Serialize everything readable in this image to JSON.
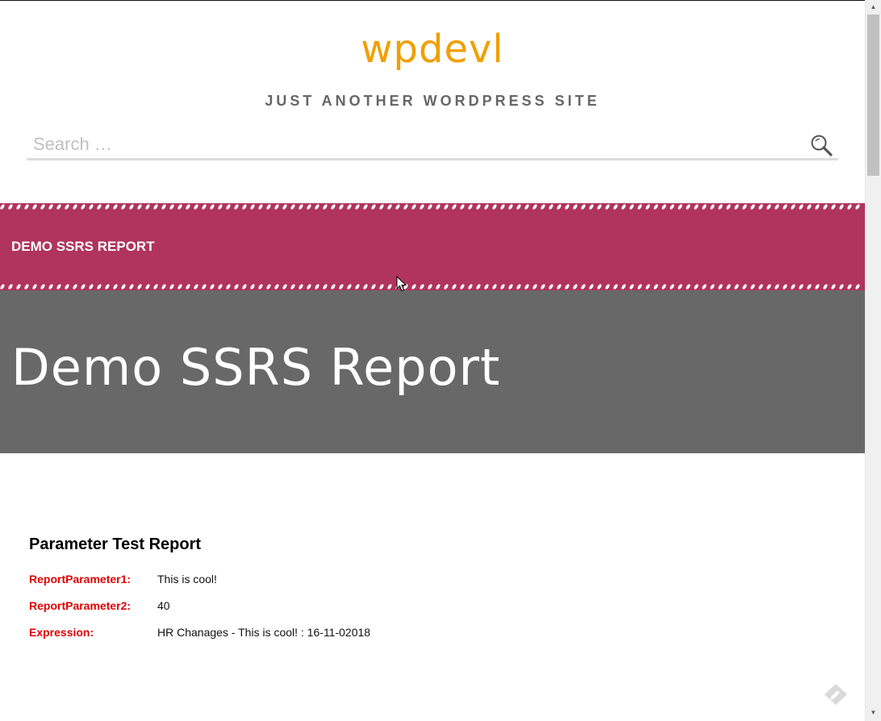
{
  "header": {
    "site_title": "wpdevl",
    "tagline": "JUST ANOTHER WORDPRESS SITE",
    "search_placeholder": "Search …"
  },
  "nav": {
    "items": [
      {
        "label": "DEMO SSRS REPORT"
      }
    ]
  },
  "hero": {
    "title": "Demo SSRS Report"
  },
  "report": {
    "title": "Parameter Test Report",
    "rows": [
      {
        "label": "ReportParameter1:",
        "value": "This is cool!"
      },
      {
        "label": "ReportParameter2:",
        "value": "40"
      },
      {
        "label": "Expression:",
        "value": "HR Chanages - This is cool! : 16-11-02018"
      }
    ]
  },
  "icons": {
    "search": "search-icon",
    "feedback": "feedback-icon",
    "scroll_up": "scroll-up-arrow-icon",
    "scroll_down": "scroll-down-arrow-icon"
  },
  "colors": {
    "site_title": "#f0a000",
    "nav_band": "#b0345d",
    "rope": "#ffffff",
    "hero_bg": "#686868",
    "param_label": "#e00000"
  }
}
